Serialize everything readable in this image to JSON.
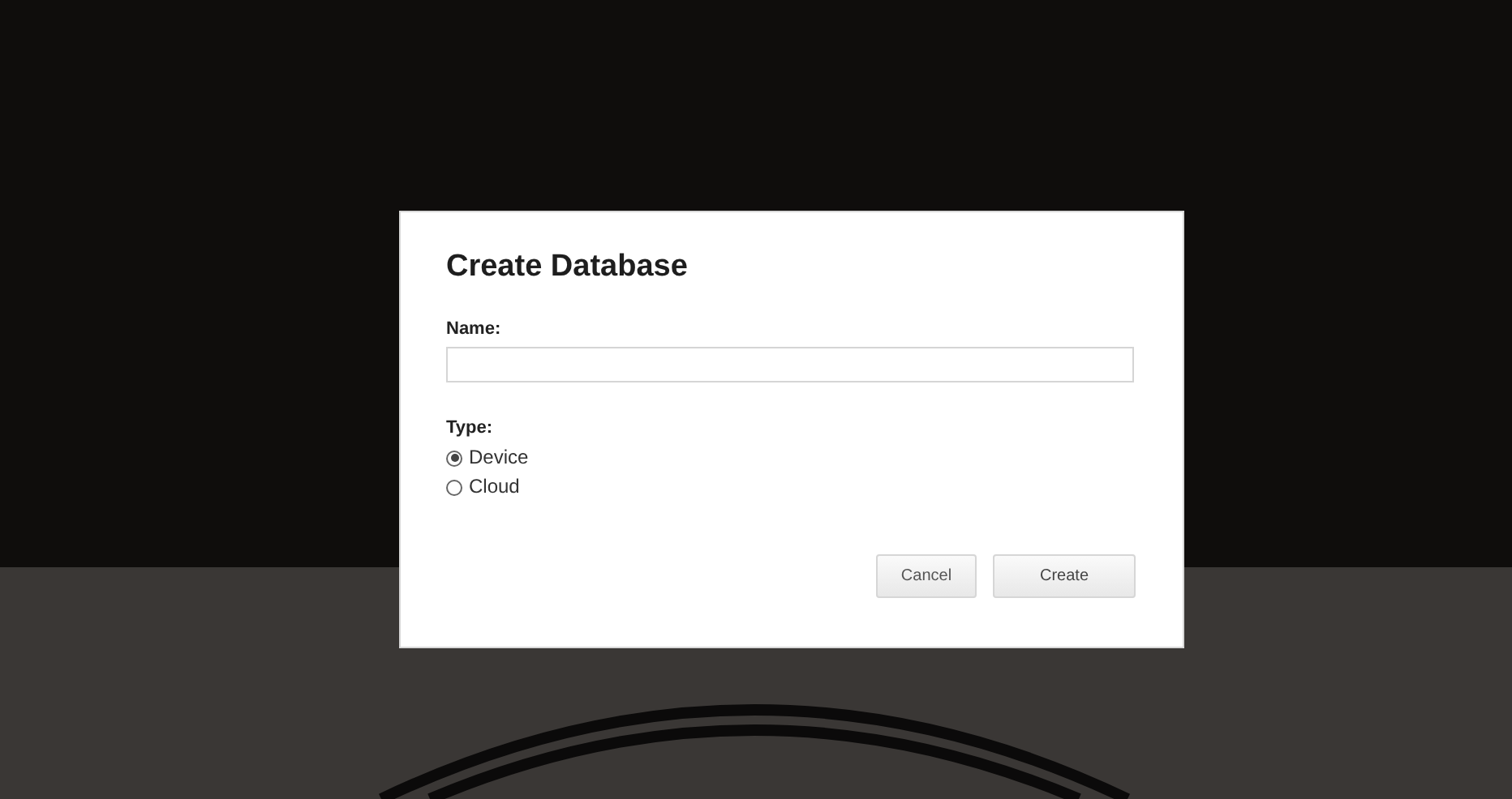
{
  "dialog": {
    "title": "Create Database",
    "name_field": {
      "label": "Name:"
    },
    "type": {
      "label": "Type:",
      "options": [
        {
          "label": "Device",
          "selected": true
        },
        {
          "label": "Cloud",
          "selected": false
        }
      ]
    },
    "buttons": [
      {
        "label": "Cancel",
        "kind": "secondary"
      },
      {
        "label": "Create",
        "kind": "primary"
      }
    ]
  }
}
